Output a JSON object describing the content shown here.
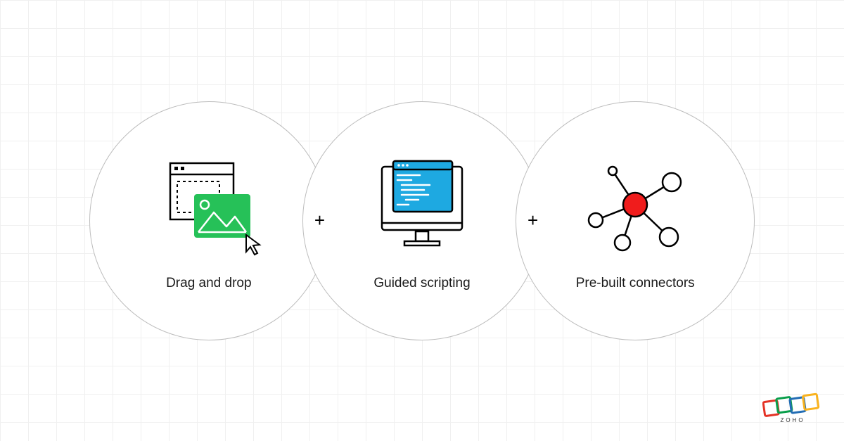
{
  "features": [
    {
      "label": "Drag and drop",
      "icon": "drag-drop-icon"
    },
    {
      "label": "Guided scripting",
      "icon": "scripting-icon"
    },
    {
      "label": "Pre-built connectors",
      "icon": "connectors-icon"
    }
  ],
  "separator": "+",
  "brand": "ZOHO",
  "colors": {
    "green": "#26c158",
    "blue": "#1ea9e1",
    "red": "#f01c1c",
    "zoho_red": "#e43225",
    "zoho_green": "#089e4a",
    "zoho_blue": "#226db4",
    "zoho_yellow": "#f9b21d"
  }
}
